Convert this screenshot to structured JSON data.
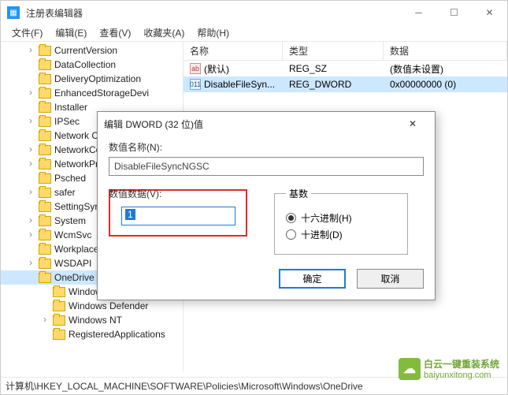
{
  "window": {
    "title": "注册表编辑器"
  },
  "menu": {
    "file": "文件(F)",
    "edit": "编辑(E)",
    "view": "查看(V)",
    "favorites": "收藏夹(A)",
    "help": "帮助(H)"
  },
  "tree": {
    "items": [
      {
        "label": "CurrentVersion",
        "exp": "›",
        "sub": false
      },
      {
        "label": "DataCollection",
        "exp": "",
        "sub": false
      },
      {
        "label": "DeliveryOptimization",
        "exp": "",
        "sub": false
      },
      {
        "label": "EnhancedStorageDevi",
        "exp": "›",
        "sub": false
      },
      {
        "label": "Installer",
        "exp": "",
        "sub": false
      },
      {
        "label": "IPSec",
        "exp": "›",
        "sub": false
      },
      {
        "label": "Network Conne",
        "exp": "",
        "sub": false
      },
      {
        "label": "NetworkConne",
        "exp": "›",
        "sub": false
      },
      {
        "label": "NetworkProvid",
        "exp": "›",
        "sub": false
      },
      {
        "label": "Psched",
        "exp": "",
        "sub": false
      },
      {
        "label": "safer",
        "exp": "›",
        "sub": false
      },
      {
        "label": "SettingSync",
        "exp": "",
        "sub": false
      },
      {
        "label": "System",
        "exp": "›",
        "sub": false
      },
      {
        "label": "WcmSvc",
        "exp": "›",
        "sub": false
      },
      {
        "label": "WorkplaceJoin",
        "exp": "",
        "sub": false
      },
      {
        "label": "WSDAPI",
        "exp": "›",
        "sub": false
      },
      {
        "label": "OneDrive",
        "exp": "",
        "sub": false,
        "selected": true
      },
      {
        "label": "Windows Advanced Threa",
        "exp": "",
        "sub": true
      },
      {
        "label": "Windows Defender",
        "exp": "",
        "sub": true
      },
      {
        "label": "Windows NT",
        "exp": "›",
        "sub": true
      },
      {
        "label": "RegisteredApplications",
        "exp": "",
        "sub": true
      }
    ]
  },
  "list": {
    "headers": {
      "name": "名称",
      "type": "类型",
      "data": "数据"
    },
    "rows": [
      {
        "icon": "str",
        "name": "(默认)",
        "type": "REG_SZ",
        "data": "(数值未设置)",
        "selected": false
      },
      {
        "icon": "dw",
        "name": "DisableFileSyn...",
        "type": "REG_DWORD",
        "data": "0x00000000 (0)",
        "selected": true
      }
    ]
  },
  "dialog": {
    "title": "编辑 DWORD (32 位)值",
    "name_label": "数值名称(N):",
    "name_value": "DisableFileSyncNGSC",
    "value_label": "数值数据(V):",
    "value_value": "1",
    "base_legend": "基数",
    "radio_hex": "十六进制(H)",
    "radio_dec": "十进制(D)",
    "ok": "确定",
    "cancel": "取消"
  },
  "status": {
    "path": "计算机\\HKEY_LOCAL_MACHINE\\SOFTWARE\\Policies\\Microsoft\\Windows\\OneDrive"
  },
  "watermark": {
    "text": "白云一键重装系统",
    "url": "baiyunxitong.com"
  }
}
